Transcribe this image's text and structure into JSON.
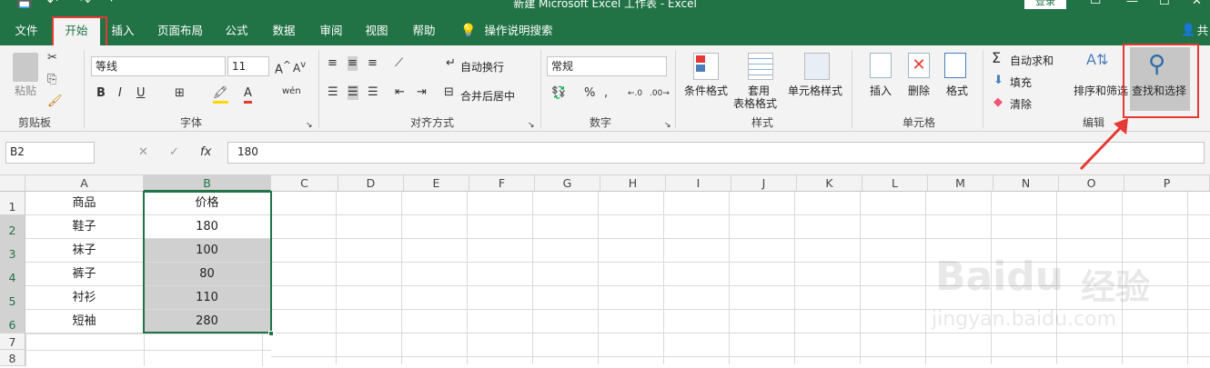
{
  "title": "新建 Microsoft Excel 工作表 - Excel",
  "account_label": "登录",
  "tabs": [
    "文件",
    "开始",
    "插入",
    "页面布局",
    "公式",
    "数据",
    "审阅",
    "视图",
    "帮助"
  ],
  "tell_me": "操作说明搜索",
  "share_label": "共",
  "clipboard": {
    "paste": "粘贴",
    "group": "剪贴板"
  },
  "font": {
    "name": "等线",
    "size": "11",
    "bold": "B",
    "italic": "I",
    "underline": "U",
    "phonetic": "wén",
    "group": "字体"
  },
  "alignment": {
    "wrap": "自动换行",
    "merge": "合并后居中",
    "group": "对齐方式"
  },
  "number": {
    "format": "常规",
    "percent": "%",
    "comma": ",",
    "group": "数字"
  },
  "styles": {
    "conditional": "条件格式",
    "table_line1": "套用",
    "table_line2": "表格格式",
    "cell_styles": "单元格样式",
    "group": "样式"
  },
  "cells": {
    "insert": "插入",
    "delete": "删除",
    "format": "格式",
    "group": "单元格"
  },
  "editing": {
    "autosum": "自动求和",
    "fill": "填充",
    "clear": "清除",
    "sort": "排序和筛选",
    "find": "查找和选择",
    "group": "编辑"
  },
  "formula_bar": {
    "name_box": "B2",
    "value": "180",
    "fx": "fx"
  },
  "columns": [
    "A",
    "B",
    "C",
    "D",
    "E",
    "F",
    "G",
    "H",
    "I",
    "J",
    "K",
    "L",
    "M",
    "N",
    "O",
    "P"
  ],
  "rows": [
    "1",
    "2",
    "3",
    "4",
    "5",
    "6",
    "7",
    "8"
  ],
  "sheet": {
    "a": [
      "商品",
      "鞋子",
      "袜子",
      "裤子",
      "衬衫",
      "短袖"
    ],
    "b": [
      "价格",
      "180",
      "100",
      "80",
      "110",
      "280"
    ]
  },
  "watermark": {
    "brand": "Baidu",
    "brand_cn": "经验",
    "url": "jingyan.baidu.com"
  },
  "colors": {
    "accent": "#217346",
    "highlight": "#e53935",
    "ribbon": "#f3f3f3",
    "selected": "#d0d0d0"
  }
}
